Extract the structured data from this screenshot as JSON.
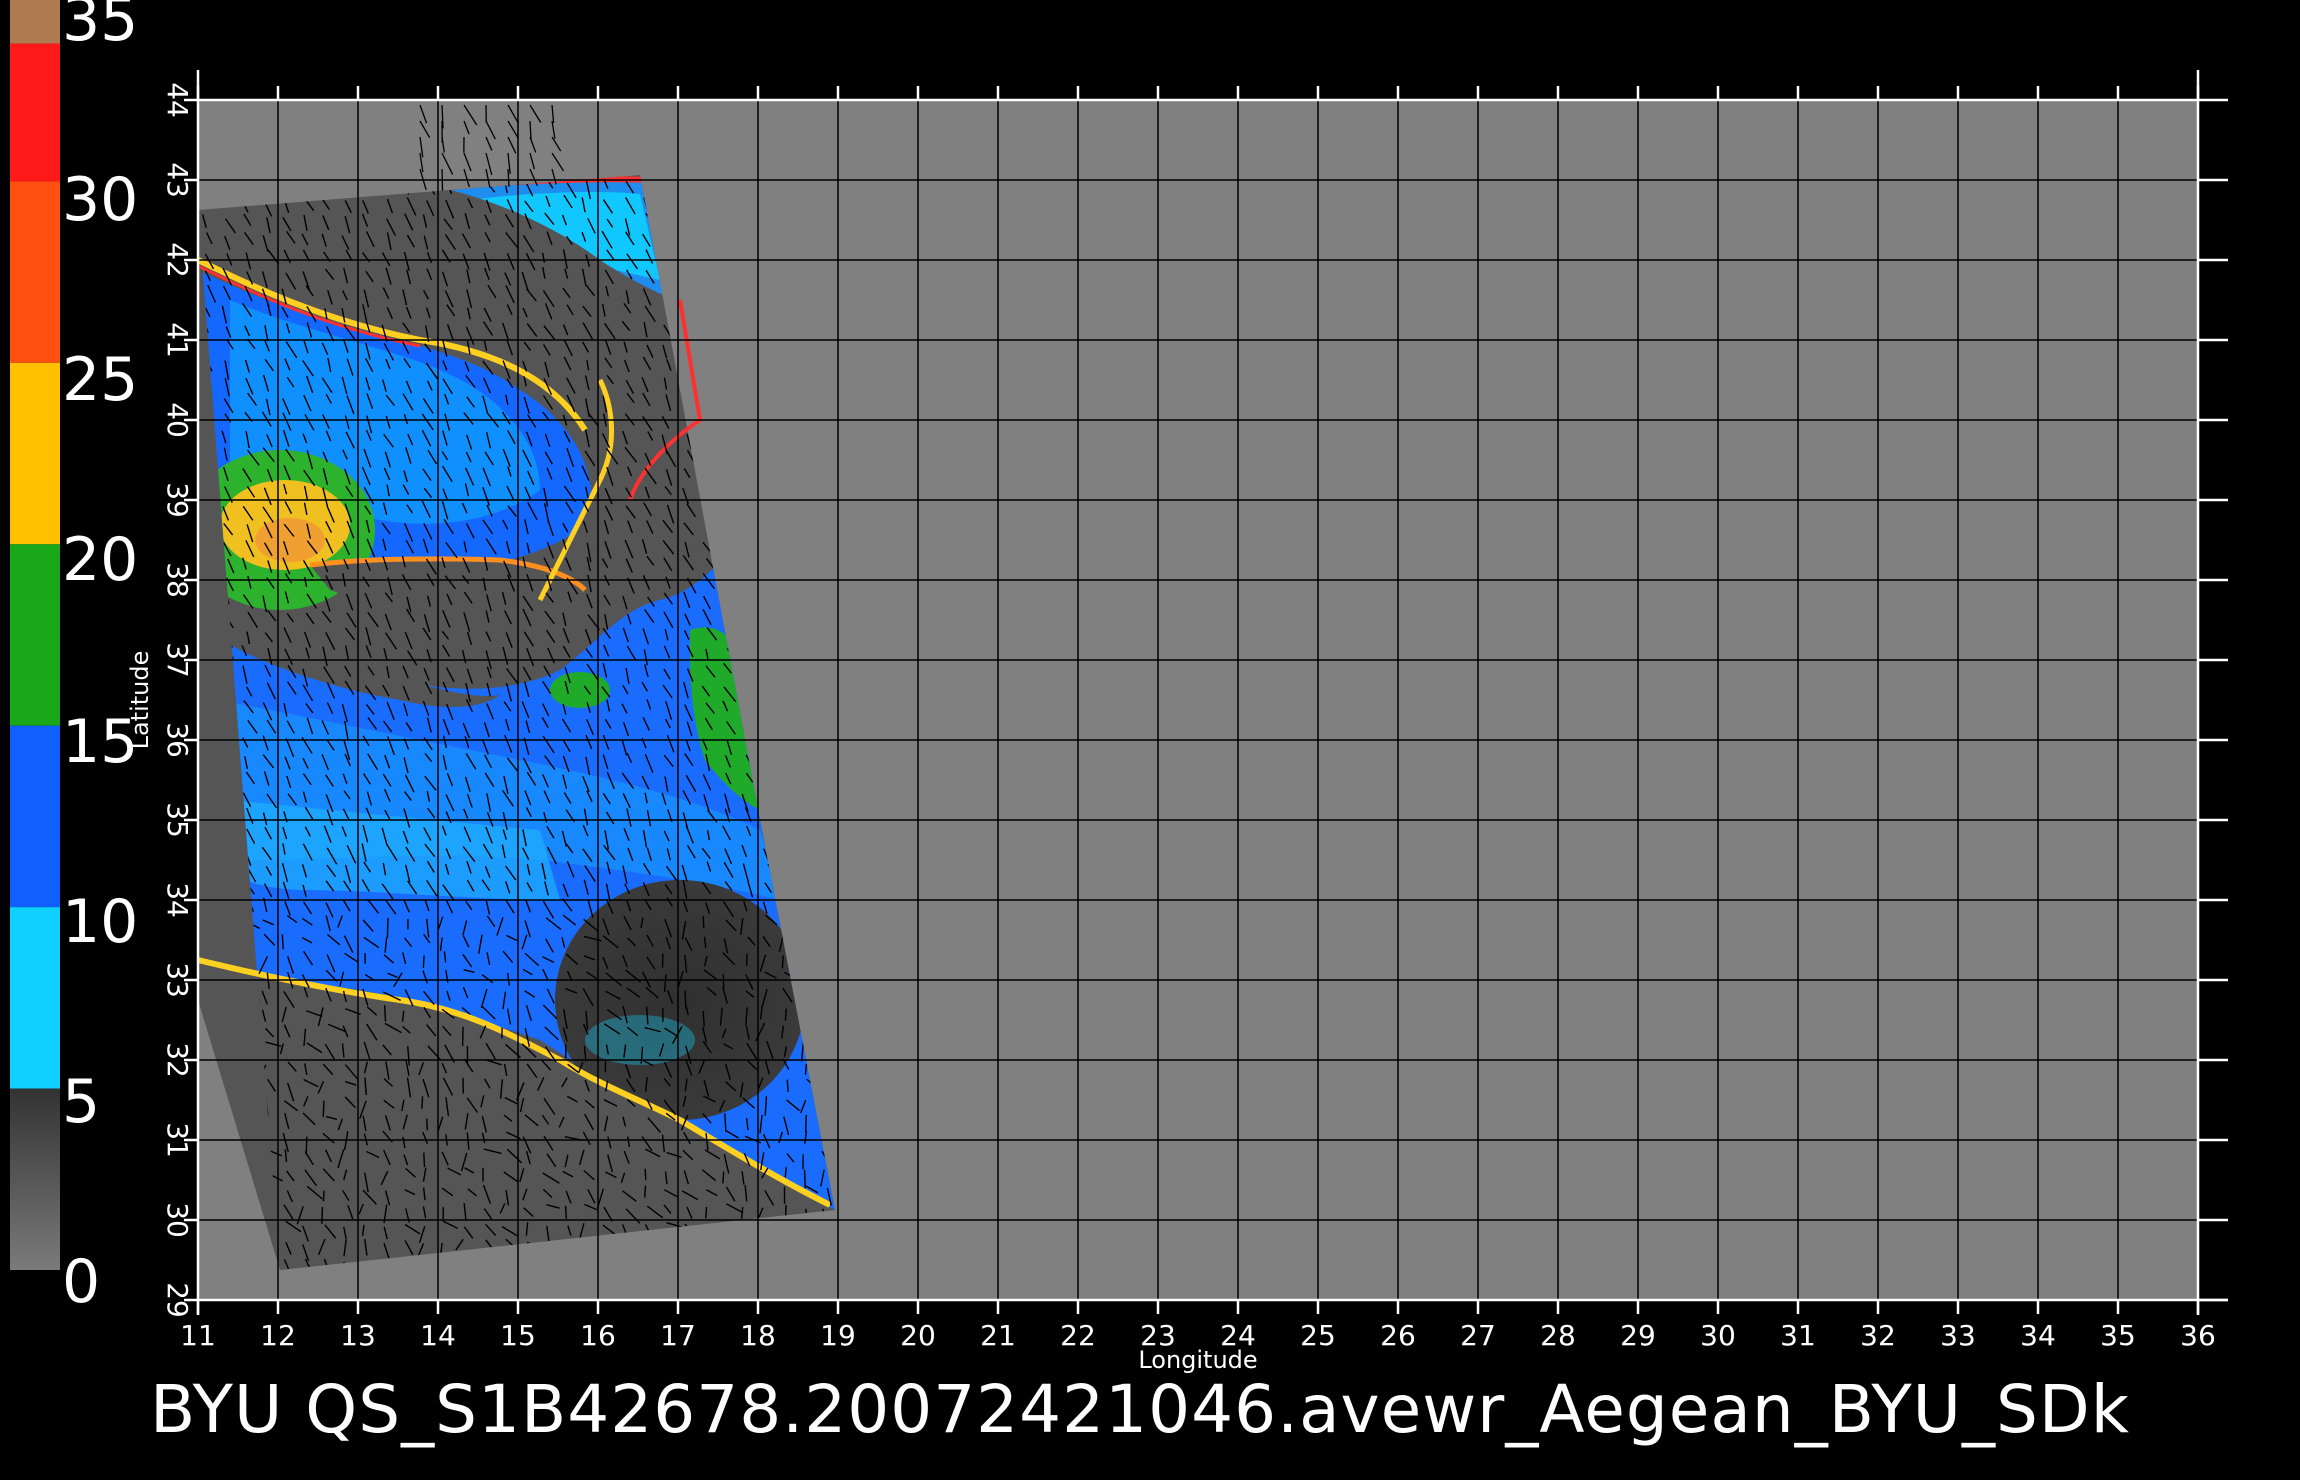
{
  "caption": "BYU  QS_S1B42678.20072421046.avewr_Aegean_BYU_SDk",
  "colorbar": {
    "labels": [
      "35",
      "30",
      "25",
      "20",
      "15",
      "10",
      "5",
      "0"
    ],
    "segments": [
      {
        "color": "#b07a50",
        "from": 33.8,
        "to": 35
      },
      {
        "color": "#ff1a1a",
        "from": 30,
        "to": 33.8
      },
      {
        "color": "#ff5010",
        "from": 25,
        "to": 30
      },
      {
        "color": "#ffc000",
        "from": 20,
        "to": 25
      },
      {
        "color": "#18a818",
        "from": 15,
        "to": 20
      },
      {
        "color": "#1060ff",
        "from": 10,
        "to": 15
      },
      {
        "color": "#10d0ff",
        "from": 5,
        "to": 10
      },
      {
        "color": "#444444",
        "from": 0,
        "to": 5
      }
    ]
  },
  "map": {
    "x_axis": {
      "title": "Longitude",
      "ticks": [
        "11",
        "12",
        "13",
        "14",
        "15",
        "16",
        "17",
        "18",
        "19",
        "20",
        "21",
        "22",
        "23",
        "24",
        "25",
        "26",
        "27",
        "28",
        "29",
        "30",
        "31",
        "32",
        "33",
        "34",
        "35",
        "36"
      ]
    },
    "y_axis": {
      "title": "Latitude",
      "ticks": [
        "29",
        "30",
        "31",
        "32",
        "33",
        "34",
        "35",
        "36",
        "37",
        "38",
        "39",
        "40",
        "41",
        "42",
        "43",
        "44"
      ]
    },
    "colors": {
      "background": "#000000",
      "no_data": "#808080",
      "swath_land": "#555555",
      "low_wind": "#383838",
      "grid": "#000000",
      "frame": "#ffffff"
    }
  }
}
